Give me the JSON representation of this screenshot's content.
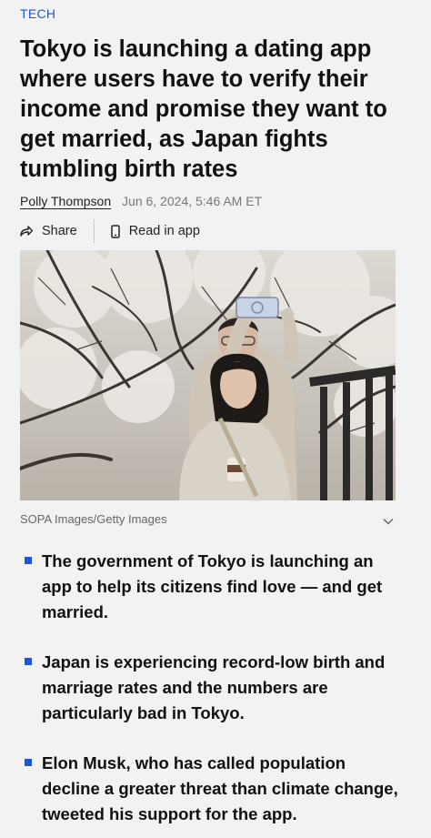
{
  "category": "TECH",
  "headline": "Tokyo is launching a dating app where users have to verify their income and promise they want to get married, as Japan fights tumbling birth rates",
  "byline": {
    "author": "Polly Thompson",
    "date": "Jun 6, 2024, 5:46 AM ET"
  },
  "actions": {
    "share_label": "Share",
    "read_in_app_label": "Read in app"
  },
  "photo": {
    "credit": "SOPA Images/Getty Images"
  },
  "bullets": [
    "The government of Tokyo is launching an app to help its citizens find love — and get married.",
    "Japan is experiencing record-low birth and marriage rates and the numbers are particularly bad in Tokyo.",
    "Elon Musk, who has called population decline a greater threat than climate change, tweeted his support for the app."
  ],
  "colors": {
    "accent": "#1a57d6",
    "background": "#f2f2f2",
    "text": "#111111"
  }
}
